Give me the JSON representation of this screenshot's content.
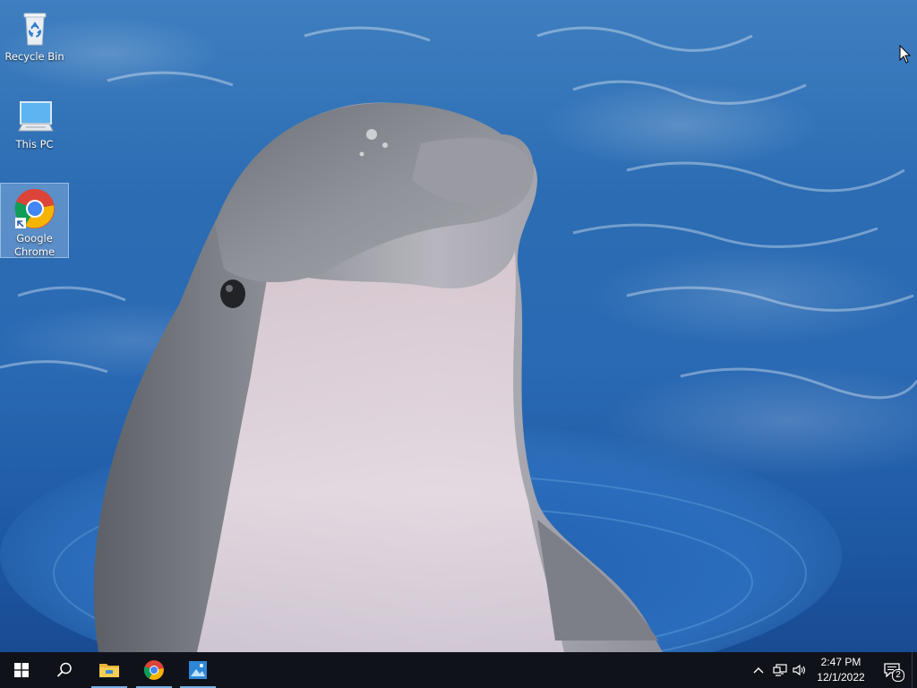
{
  "desktop": {
    "icons": [
      {
        "label": "Recycle Bin",
        "icon": "recycle-bin-icon"
      },
      {
        "label": "This PC",
        "icon": "computer-icon"
      },
      {
        "label": "Google Chrome",
        "icon": "chrome-icon"
      }
    ]
  },
  "taskbar": {
    "apps": [
      {
        "icon": "windows-start-icon"
      },
      {
        "icon": "search-icon"
      },
      {
        "icon": "file-explorer-icon",
        "running": true
      },
      {
        "icon": "chrome-icon",
        "running": true
      },
      {
        "icon": "photos-icon",
        "running": true
      }
    ],
    "tray": {
      "icons": [
        "chevron-up-icon",
        "network-icon",
        "volume-icon"
      ],
      "time": "2:47 PM",
      "date": "12/1/2022",
      "notification_count": "2"
    }
  },
  "colors": {
    "taskbar_bg": "#0f1218",
    "running_indicator": "#7ab1e8",
    "water": "#2a6ab4"
  }
}
